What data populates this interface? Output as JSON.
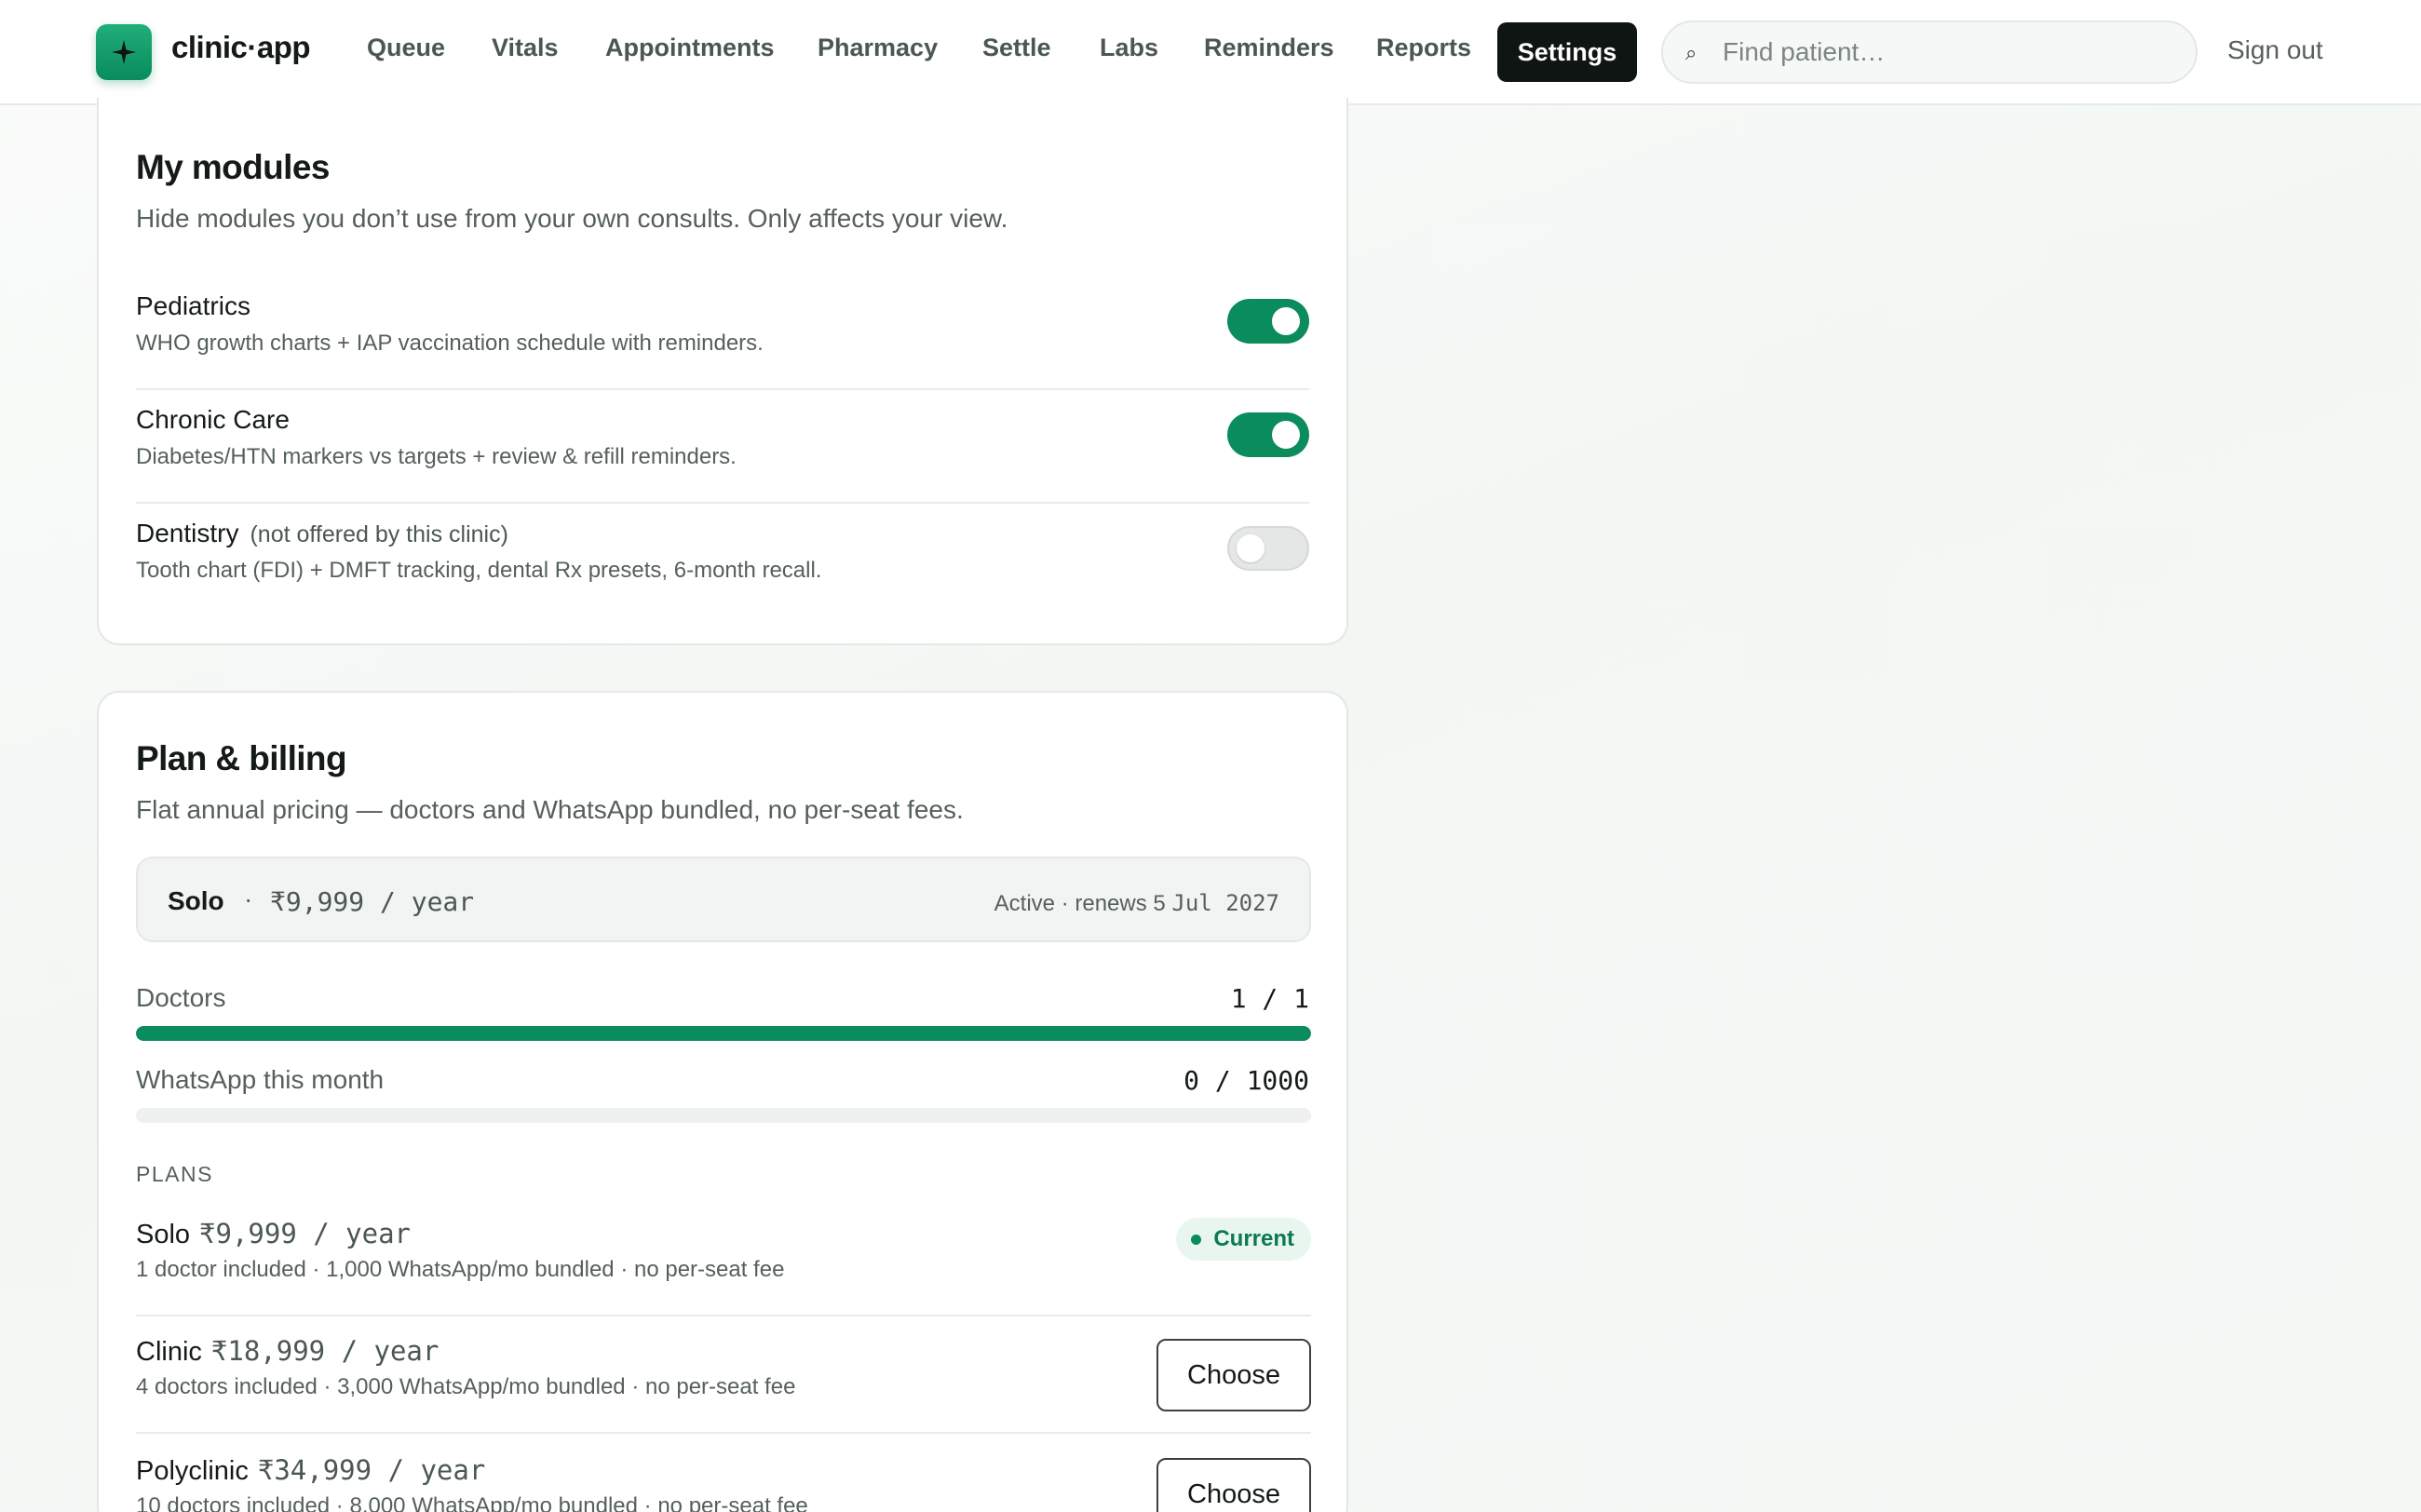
{
  "app": {
    "name": "clinic·app"
  },
  "nav": {
    "items": [
      "Queue",
      "Vitals",
      "Appointments",
      "Pharmacy",
      "Settle",
      "Labs",
      "Reminders",
      "Reports"
    ],
    "active": "Settings",
    "search_placeholder": "Find patient…",
    "search_icon": "⌕",
    "sign_out": "Sign out"
  },
  "modules": {
    "title": "My modules",
    "subtitle": "Hide modules you don’t use from your own consults. Only affects your view.",
    "items": [
      {
        "name": "Pediatrics",
        "note": "",
        "desc": "WHO growth charts + IAP vaccination schedule with reminders.",
        "enabled": true
      },
      {
        "name": "Chronic Care",
        "note": "",
        "desc": "Diabetes/HTN markers vs targets + review & refill reminders.",
        "enabled": true
      },
      {
        "name": "Dentistry",
        "note": "(not offered by this clinic)",
        "desc": "Tooth chart (FDI) + DMFT tracking, dental Rx presets, 6-month recall.",
        "enabled": false
      }
    ]
  },
  "billing": {
    "title": "Plan & billing",
    "subtitle": "Flat annual pricing — doctors and WhatsApp bundled, no per-seat fees.",
    "current": {
      "name": "Solo",
      "separator": "·",
      "price": "₹9,999 / year",
      "status_prefix": "Active · renews 5 ",
      "status_date": "Jul 2027"
    },
    "usage": [
      {
        "label": "Doctors",
        "value": "1 / 1",
        "fraction": 1.0
      },
      {
        "label": "WhatsApp this month",
        "value": "0 / 1000",
        "fraction": 0.0
      }
    ],
    "plans_heading": "PLANS",
    "plans": [
      {
        "name": "Solo",
        "price": "₹9,999 / year",
        "desc": "1 doctor included · 1,000 WhatsApp/mo bundled · no per-seat fee",
        "current": true,
        "badge": "Current"
      },
      {
        "name": "Clinic",
        "price": "₹18,999 / year",
        "desc": "4 doctors included · 3,000 WhatsApp/mo bundled · no per-seat fee",
        "current": false,
        "action": "Choose"
      },
      {
        "name": "Polyclinic",
        "price": "₹34,999 / year",
        "desc": "10 doctors included · 8,000 WhatsApp/mo bundled · no per-seat fee",
        "current": false,
        "action": "Choose"
      }
    ]
  },
  "colors": {
    "accent": "#0a8c5c",
    "active_nav_bg": "#0f1512"
  }
}
